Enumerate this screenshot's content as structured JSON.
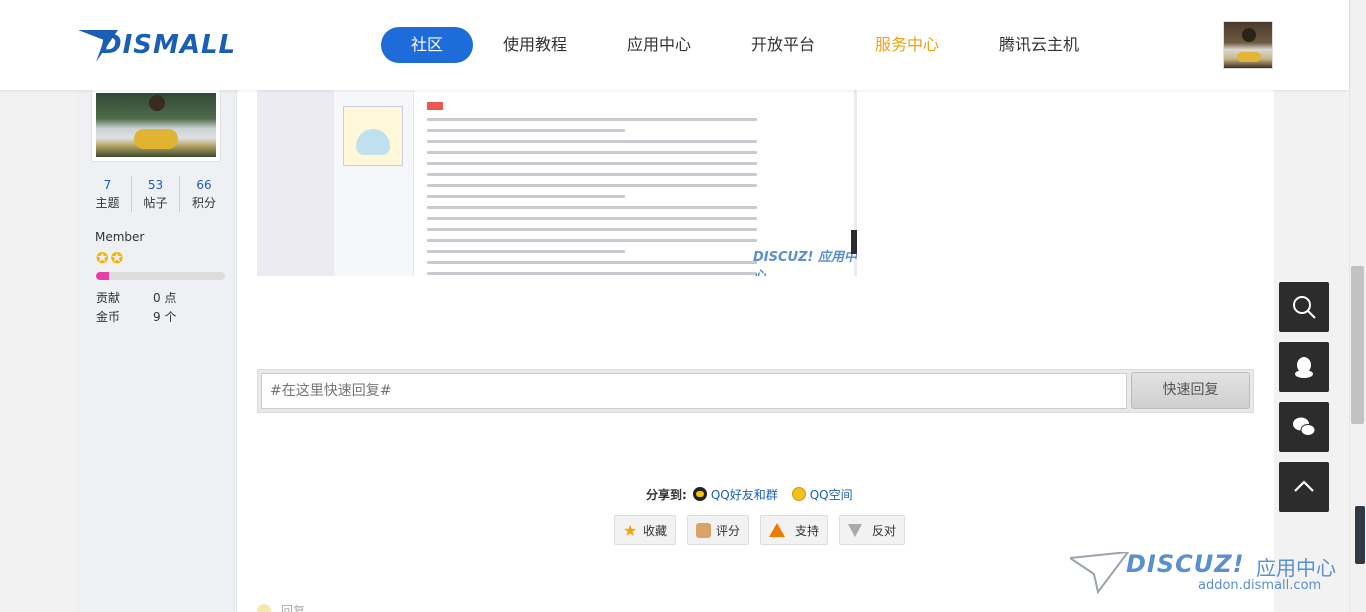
{
  "header": {
    "logo_text": "DISMALL",
    "nav": [
      {
        "label": "社区",
        "active": true
      },
      {
        "label": "使用教程"
      },
      {
        "label": "应用中心"
      },
      {
        "label": "开放平台"
      },
      {
        "label": "服务中心",
        "highlight": true
      },
      {
        "label": "腾讯云主机"
      }
    ]
  },
  "sidebar": {
    "stats": [
      {
        "value": "7",
        "label": "主题"
      },
      {
        "value": "53",
        "label": "帖子"
      },
      {
        "value": "66",
        "label": "积分"
      }
    ],
    "group": "Member",
    "stars": 2,
    "progress_fraction": 0.1,
    "credits": [
      {
        "key": "贡献",
        "value": "0 点"
      },
      {
        "key": "金币",
        "value": "9 个"
      }
    ]
  },
  "post_image": {
    "watermark": "DISCUZ! 应用中心"
  },
  "reply": {
    "placeholder": "#在这里快速回复#",
    "button": "快速回复"
  },
  "share": {
    "label": "分享到:",
    "links": [
      "QQ好友和群",
      "QQ空间"
    ]
  },
  "actions": [
    "收藏",
    "评分",
    "支持",
    "反对"
  ],
  "bottom_reply": "回复",
  "watermark": {
    "brand": "DISCUZ!",
    "suffix": "应用中心",
    "site": "addon.dismall.com"
  },
  "colors": {
    "accent": "#1e6cd9",
    "highlight": "#e8a317",
    "tool_bg": "#2c2c2c"
  }
}
